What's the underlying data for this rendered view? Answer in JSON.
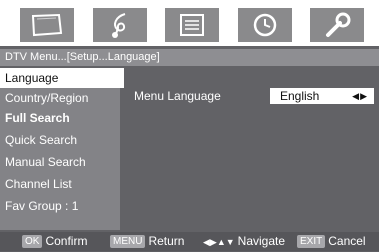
{
  "menu_tiles": [
    {
      "icon": "tv-screen-icon"
    },
    {
      "icon": "music-note-icon"
    },
    {
      "icon": "settings-panel-icon"
    },
    {
      "icon": "clock-icon"
    },
    {
      "icon": "wrench-icon"
    }
  ],
  "breadcrumb": "DTV Menu...[Setup...Language]",
  "sidebar": {
    "items": [
      {
        "label": "Language"
      },
      {
        "label": "Country/Region"
      },
      {
        "label": "Full Search"
      },
      {
        "label": "Quick Search"
      },
      {
        "label": "Manual Search"
      },
      {
        "label": "Channel List"
      },
      {
        "label": "Fav Group : 1"
      }
    ]
  },
  "main": {
    "setting_label": "Menu Language",
    "setting_value": "English",
    "arrows": "◀▶"
  },
  "footer": {
    "ok_key": "OK",
    "ok_label": "Confirm",
    "menu_key": "MENU",
    "menu_label": "Return",
    "nav_glyph": "◀▶▲▼",
    "nav_label": "Navigate",
    "exit_key": "EXIT",
    "exit_label": "Cancel"
  },
  "colors": {
    "background": "#626266",
    "tile": "#8a8a8c",
    "selected": "#ffffff"
  }
}
